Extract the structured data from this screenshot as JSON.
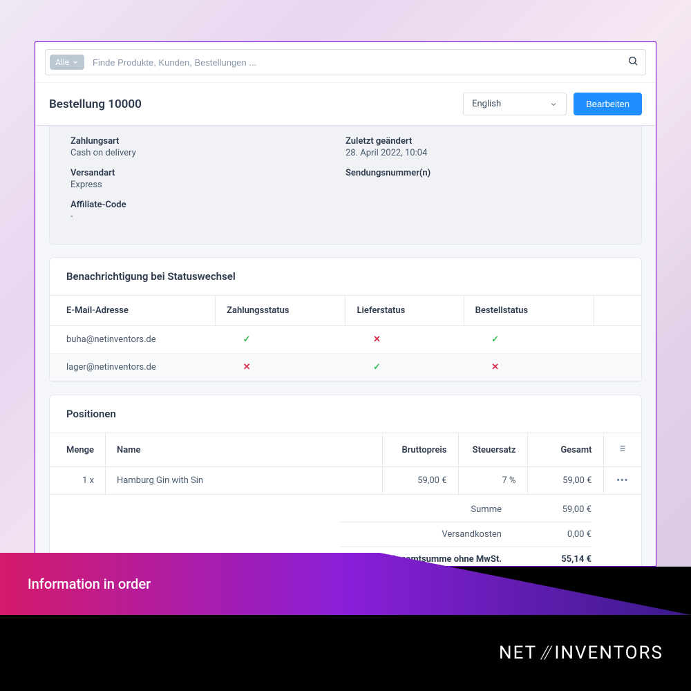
{
  "search": {
    "filter_label": "Alle",
    "placeholder": "Finde Produkte, Kunden, Bestellungen ..."
  },
  "header": {
    "title": "Bestellung 10000",
    "language": "English",
    "edit_btn": "Bearbeiten"
  },
  "order_info": {
    "left": [
      {
        "label": "Zahlungsart",
        "value": "Cash on delivery"
      },
      {
        "label": "Versandart",
        "value": "Express"
      },
      {
        "label": "Affiliate-Code",
        "value": "-"
      }
    ],
    "right": [
      {
        "label": "Zuletzt geändert",
        "value": "28. April 2022, 10:04"
      },
      {
        "label": "Sendungsnummer(n)",
        "value": ""
      }
    ]
  },
  "notifications": {
    "title": "Benachrichtigung bei Statuswechsel",
    "headers": {
      "email": "E-Mail-Adresse",
      "payment": "Zahlungsstatus",
      "delivery": "Lieferstatus",
      "order": "Bestellstatus"
    },
    "rows": [
      {
        "email": "buha@netinventors.de",
        "payment": true,
        "delivery": false,
        "order": true
      },
      {
        "email": "lager@netinventors.de",
        "payment": false,
        "delivery": true,
        "order": false
      }
    ]
  },
  "positions": {
    "title": "Positionen",
    "headers": {
      "qty": "Menge",
      "name": "Name",
      "gross": "Bruttopreis",
      "tax": "Steuersatz",
      "total": "Gesamt"
    },
    "rows": [
      {
        "qty": "1 x",
        "name": "Hamburg Gin with Sin",
        "gross": "59,00 €",
        "tax": "7 %",
        "total": "59,00 €"
      }
    ],
    "totals": [
      {
        "label": "Summe",
        "value": "59,00 €",
        "strong": false
      },
      {
        "label": "Versandkosten",
        "value": "0,00 €",
        "strong": false
      },
      {
        "label": "Gesamtsumme ohne MwSt.",
        "value": "55,14 €",
        "strong": true
      }
    ]
  },
  "caption": "Information in order",
  "brand": {
    "part1": "NET",
    "part2": "INVENTORS"
  }
}
